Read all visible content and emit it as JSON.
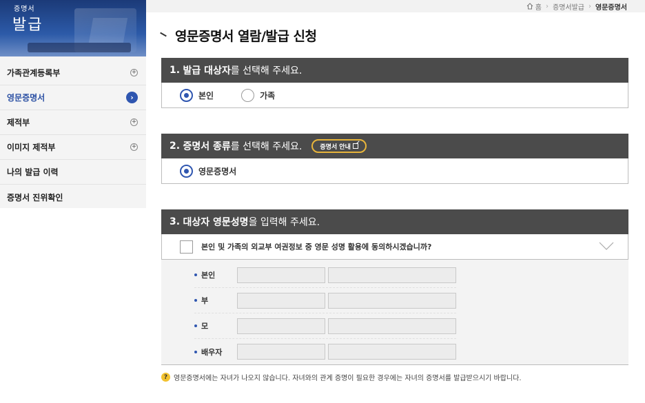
{
  "sidebar": {
    "banner_small": "증명서",
    "banner_big": "발급",
    "items": [
      {
        "label": "가족관계등록부",
        "icon": "plus-circle-icon",
        "active": false
      },
      {
        "label": "영문증명서",
        "icon": "arrow-circle-icon",
        "active": true
      },
      {
        "label": "제적부",
        "icon": "plus-circle-icon",
        "active": false
      },
      {
        "label": "이미지 제적부",
        "icon": "plus-circle-icon",
        "active": false
      },
      {
        "label": "나의 발급 이력",
        "icon": "",
        "active": false
      },
      {
        "label": "증명서 진위확인",
        "icon": "",
        "active": false
      }
    ]
  },
  "breadcrumb": {
    "home": "홈",
    "level1": "증명서발급",
    "current": "영문증명서"
  },
  "page_title": "영문증명서 열람/발급 신청",
  "section1": {
    "number": "1.",
    "bold": "발급 대상자",
    "rest": "를 선택해 주세요.",
    "options": [
      {
        "label": "본인",
        "selected": true
      },
      {
        "label": "가족",
        "selected": false
      }
    ]
  },
  "section2": {
    "number": "2.",
    "bold": "증명서 종류",
    "rest": "를 선택해 주세요.",
    "guide_button": "증명서 안내",
    "options": [
      {
        "label": "영문증명서",
        "selected": true
      }
    ]
  },
  "section3": {
    "number": "3.",
    "bold": "대상자 영문성명",
    "rest": "을 입력해 주세요.",
    "consent_label": "본인 및 가족의 외교부 여권정보 중 영문 성명 활용에 동의하시겠습니까?",
    "rows": [
      {
        "label": "본인"
      },
      {
        "label": "부"
      },
      {
        "label": "모"
      },
      {
        "label": "배우자"
      }
    ]
  },
  "note": "영문증명서에는 자녀가 나오지 않습니다. 자녀와의 관계 증명이 필요한 경우에는 자녀의 증명서를 발급받으시기 바랍니다.",
  "colors": {
    "accent": "#2f56b0",
    "section_header": "#4b4b4b",
    "guide_border": "#e9b53a"
  }
}
